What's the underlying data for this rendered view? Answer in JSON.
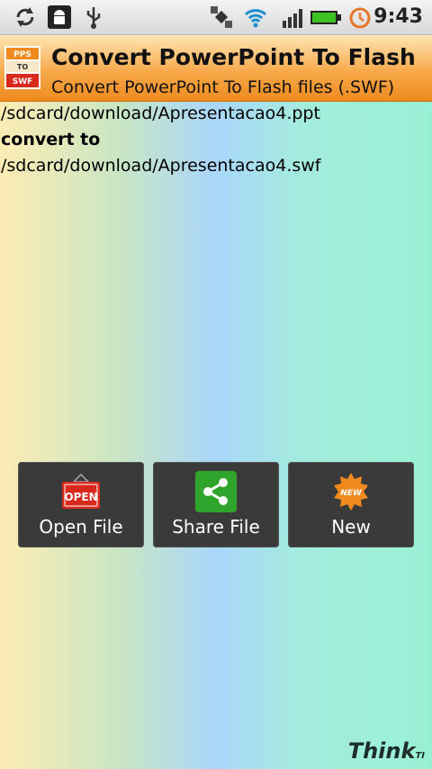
{
  "status_bar": {
    "time": "9:43",
    "icons": [
      "sync-icon",
      "android-debug-icon",
      "usb-icon",
      "gps-satellite-icon",
      "wifi-icon",
      "signal-icon",
      "battery-icon",
      "alarm-icon"
    ]
  },
  "header": {
    "icon_text": [
      "PPS",
      "TO",
      "SWF"
    ],
    "title": "Convert PowerPoint To Flash",
    "subtitle": "Convert PowerPoint To Flash files (.SWF)"
  },
  "content": {
    "source_path": "/sdcard/download/Apresentacao4.ppt",
    "convert_label": "convert to",
    "target_path": "/sdcard/download/Apresentacao4.swf"
  },
  "buttons": {
    "open": {
      "label": "Open File",
      "icon_text": "OPEN"
    },
    "share": {
      "label": "Share File"
    },
    "new": {
      "label": "New",
      "icon_text": "NEW"
    }
  },
  "brand": {
    "text": "Think",
    "suffix": "TI"
  },
  "colors": {
    "header_orange": "#f7a94c",
    "button_bg": "#3a3a3a",
    "open_red": "#d9291c",
    "share_green": "#2fa52c",
    "new_orange": "#f08a1e"
  }
}
